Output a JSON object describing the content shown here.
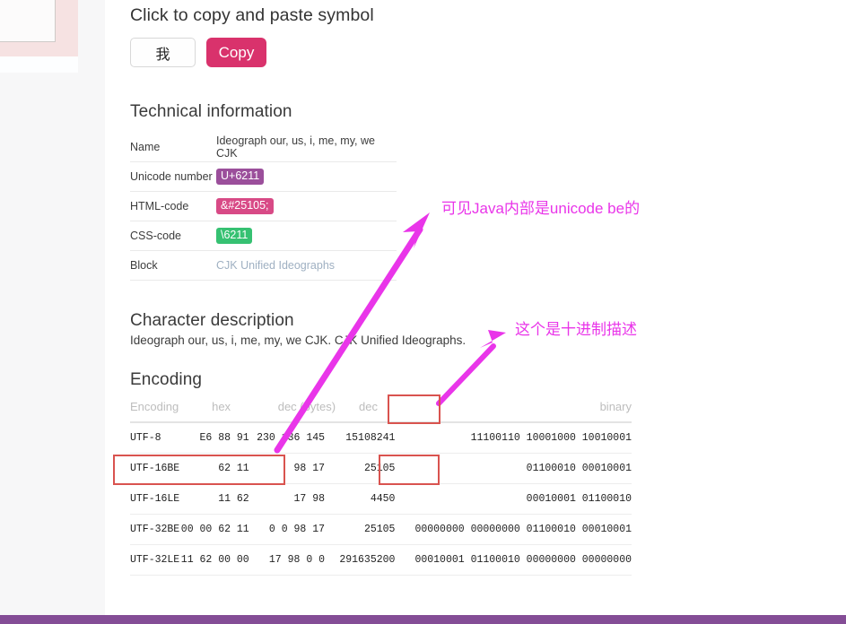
{
  "copy_section": {
    "heading": "Click to copy and paste symbol",
    "symbol": "我",
    "copy_label": "Copy"
  },
  "technical": {
    "heading": "Technical information",
    "rows": [
      {
        "key": "Name",
        "value": "Ideograph our, us, i, me, my, we CJK",
        "style": "plain"
      },
      {
        "key": "Unicode number",
        "value": "U+6211",
        "style": "badge-purple"
      },
      {
        "key": "HTML-code",
        "value": "&#25105;",
        "style": "badge-pink"
      },
      {
        "key": "CSS-code",
        "value": "\\6211",
        "style": "badge-green"
      },
      {
        "key": "Block",
        "value": "CJK Unified Ideographs",
        "style": "link"
      }
    ]
  },
  "character_description": {
    "heading": "Character description",
    "text": "Ideograph our, us, i, me, my, we CJK. CJK Unified Ideographs."
  },
  "encoding": {
    "heading": "Encoding",
    "columns": [
      "Encoding",
      "hex",
      "dec (bytes)",
      "dec",
      "binary"
    ],
    "rows": [
      {
        "encoding": "UTF-8",
        "hex": "E6 88 91",
        "dec_bytes": "230 136 145",
        "dec": "15108241",
        "binary": "11100110 10001000 10010001"
      },
      {
        "encoding": "UTF-16BE",
        "hex": "62 11",
        "dec_bytes": "98 17",
        "dec": "25105",
        "binary": "01100010 00010001"
      },
      {
        "encoding": "UTF-16LE",
        "hex": "11 62",
        "dec_bytes": "17 98",
        "dec": "4450",
        "binary": "00010001 01100010"
      },
      {
        "encoding": "UTF-32BE",
        "hex": "00 00 62 11",
        "dec_bytes": "0 0 98 17",
        "dec": "25105",
        "binary": "00000000 00000000 01100010 00010001"
      },
      {
        "encoding": "UTF-32LE",
        "hex": "11 62 00 00",
        "dec_bytes": "17 98 0 0",
        "dec": "291635200",
        "binary": "00010001 01100010 00000000 00000000"
      }
    ]
  },
  "annotations": {
    "note_1": "可见Java内部是unicode be的",
    "note_2": "这个是十进制描述",
    "color_marker": "#e935e9",
    "color_highlight_box": "#d9534f"
  },
  "chrome": {
    "bottom_bar_color": "#844d96"
  }
}
